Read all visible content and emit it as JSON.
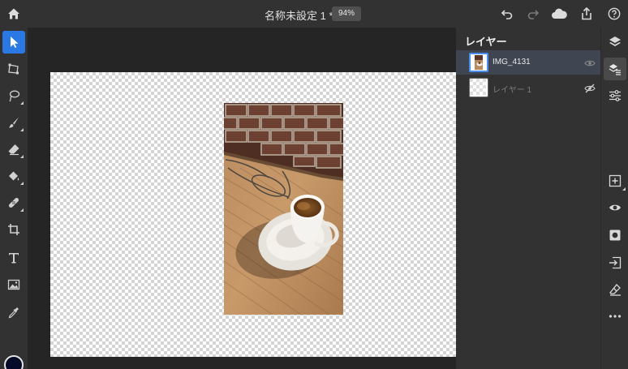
{
  "document": {
    "title": "名称未設定 1 *",
    "zoom": "94%"
  },
  "topbar": {
    "icons": [
      "home-icon",
      "undo-icon",
      "redo-icon",
      "cloud-icon",
      "share-icon",
      "help-icon"
    ]
  },
  "tools": [
    "select-icon",
    "transform-icon",
    "lasso-icon",
    "brush-icon",
    "eraser-icon",
    "paint-bucket-icon",
    "healing-icon",
    "crop-icon",
    "type-icon",
    "place-image-icon",
    "eyedropper-icon"
  ],
  "colors": {
    "foreground": "#050a28",
    "background": "#ffffff",
    "accent": "#2a78e4"
  },
  "layers_panel": {
    "title": "レイヤー",
    "layers": [
      {
        "name": "IMG_4131",
        "selected": true,
        "visible": true
      },
      {
        "name": "レイヤー 1",
        "selected": false,
        "visible": false
      }
    ]
  },
  "right_rail": {
    "icons": [
      "layers-icon",
      "layer-properties-icon",
      "adjustments-icon",
      "add-layer-icon",
      "visibility-icon",
      "mask-icon",
      "import-icon",
      "clear-icon",
      "more-icon"
    ]
  }
}
